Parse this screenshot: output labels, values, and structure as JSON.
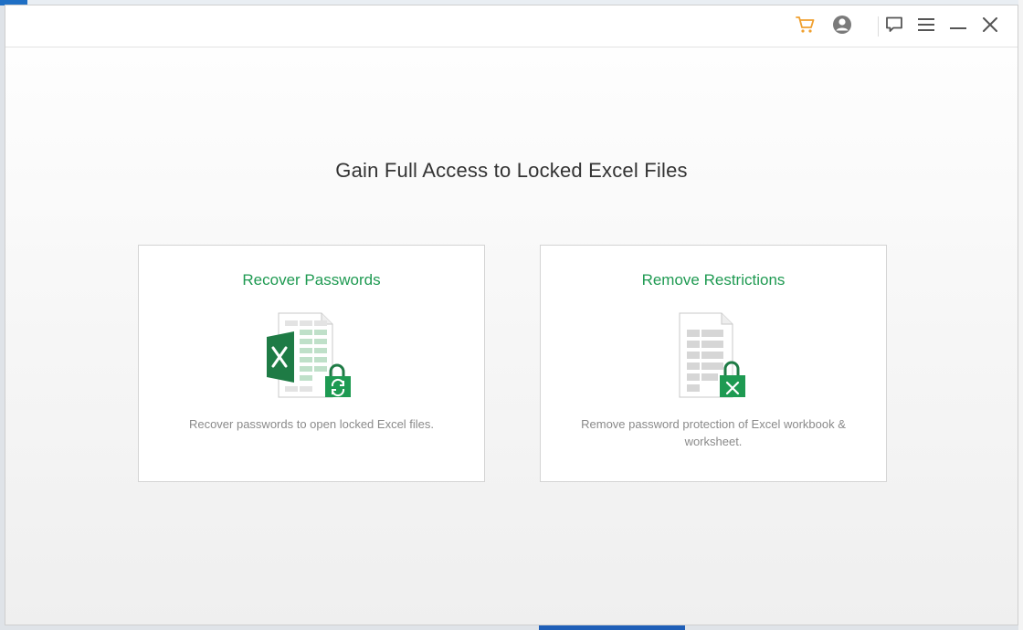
{
  "window": {
    "headline": "Gain Full Access to Locked Excel Files"
  },
  "toolbar": {
    "icons": [
      "cart-icon",
      "user-icon",
      "feedback-icon",
      "menu-icon",
      "minimize-icon",
      "close-icon"
    ],
    "accent_color": "#f0a030"
  },
  "cards": [
    {
      "title": "Recover Passwords",
      "description": "Recover passwords to open locked Excel files.",
      "icon": "excel-recover-icon"
    },
    {
      "title": "Remove Restrictions",
      "description": "Remove password protection of Excel workbook & worksheet.",
      "icon": "excel-unlock-icon"
    }
  ],
  "colors": {
    "title_green": "#1f9a52",
    "excel_green": "#1e7b45"
  }
}
